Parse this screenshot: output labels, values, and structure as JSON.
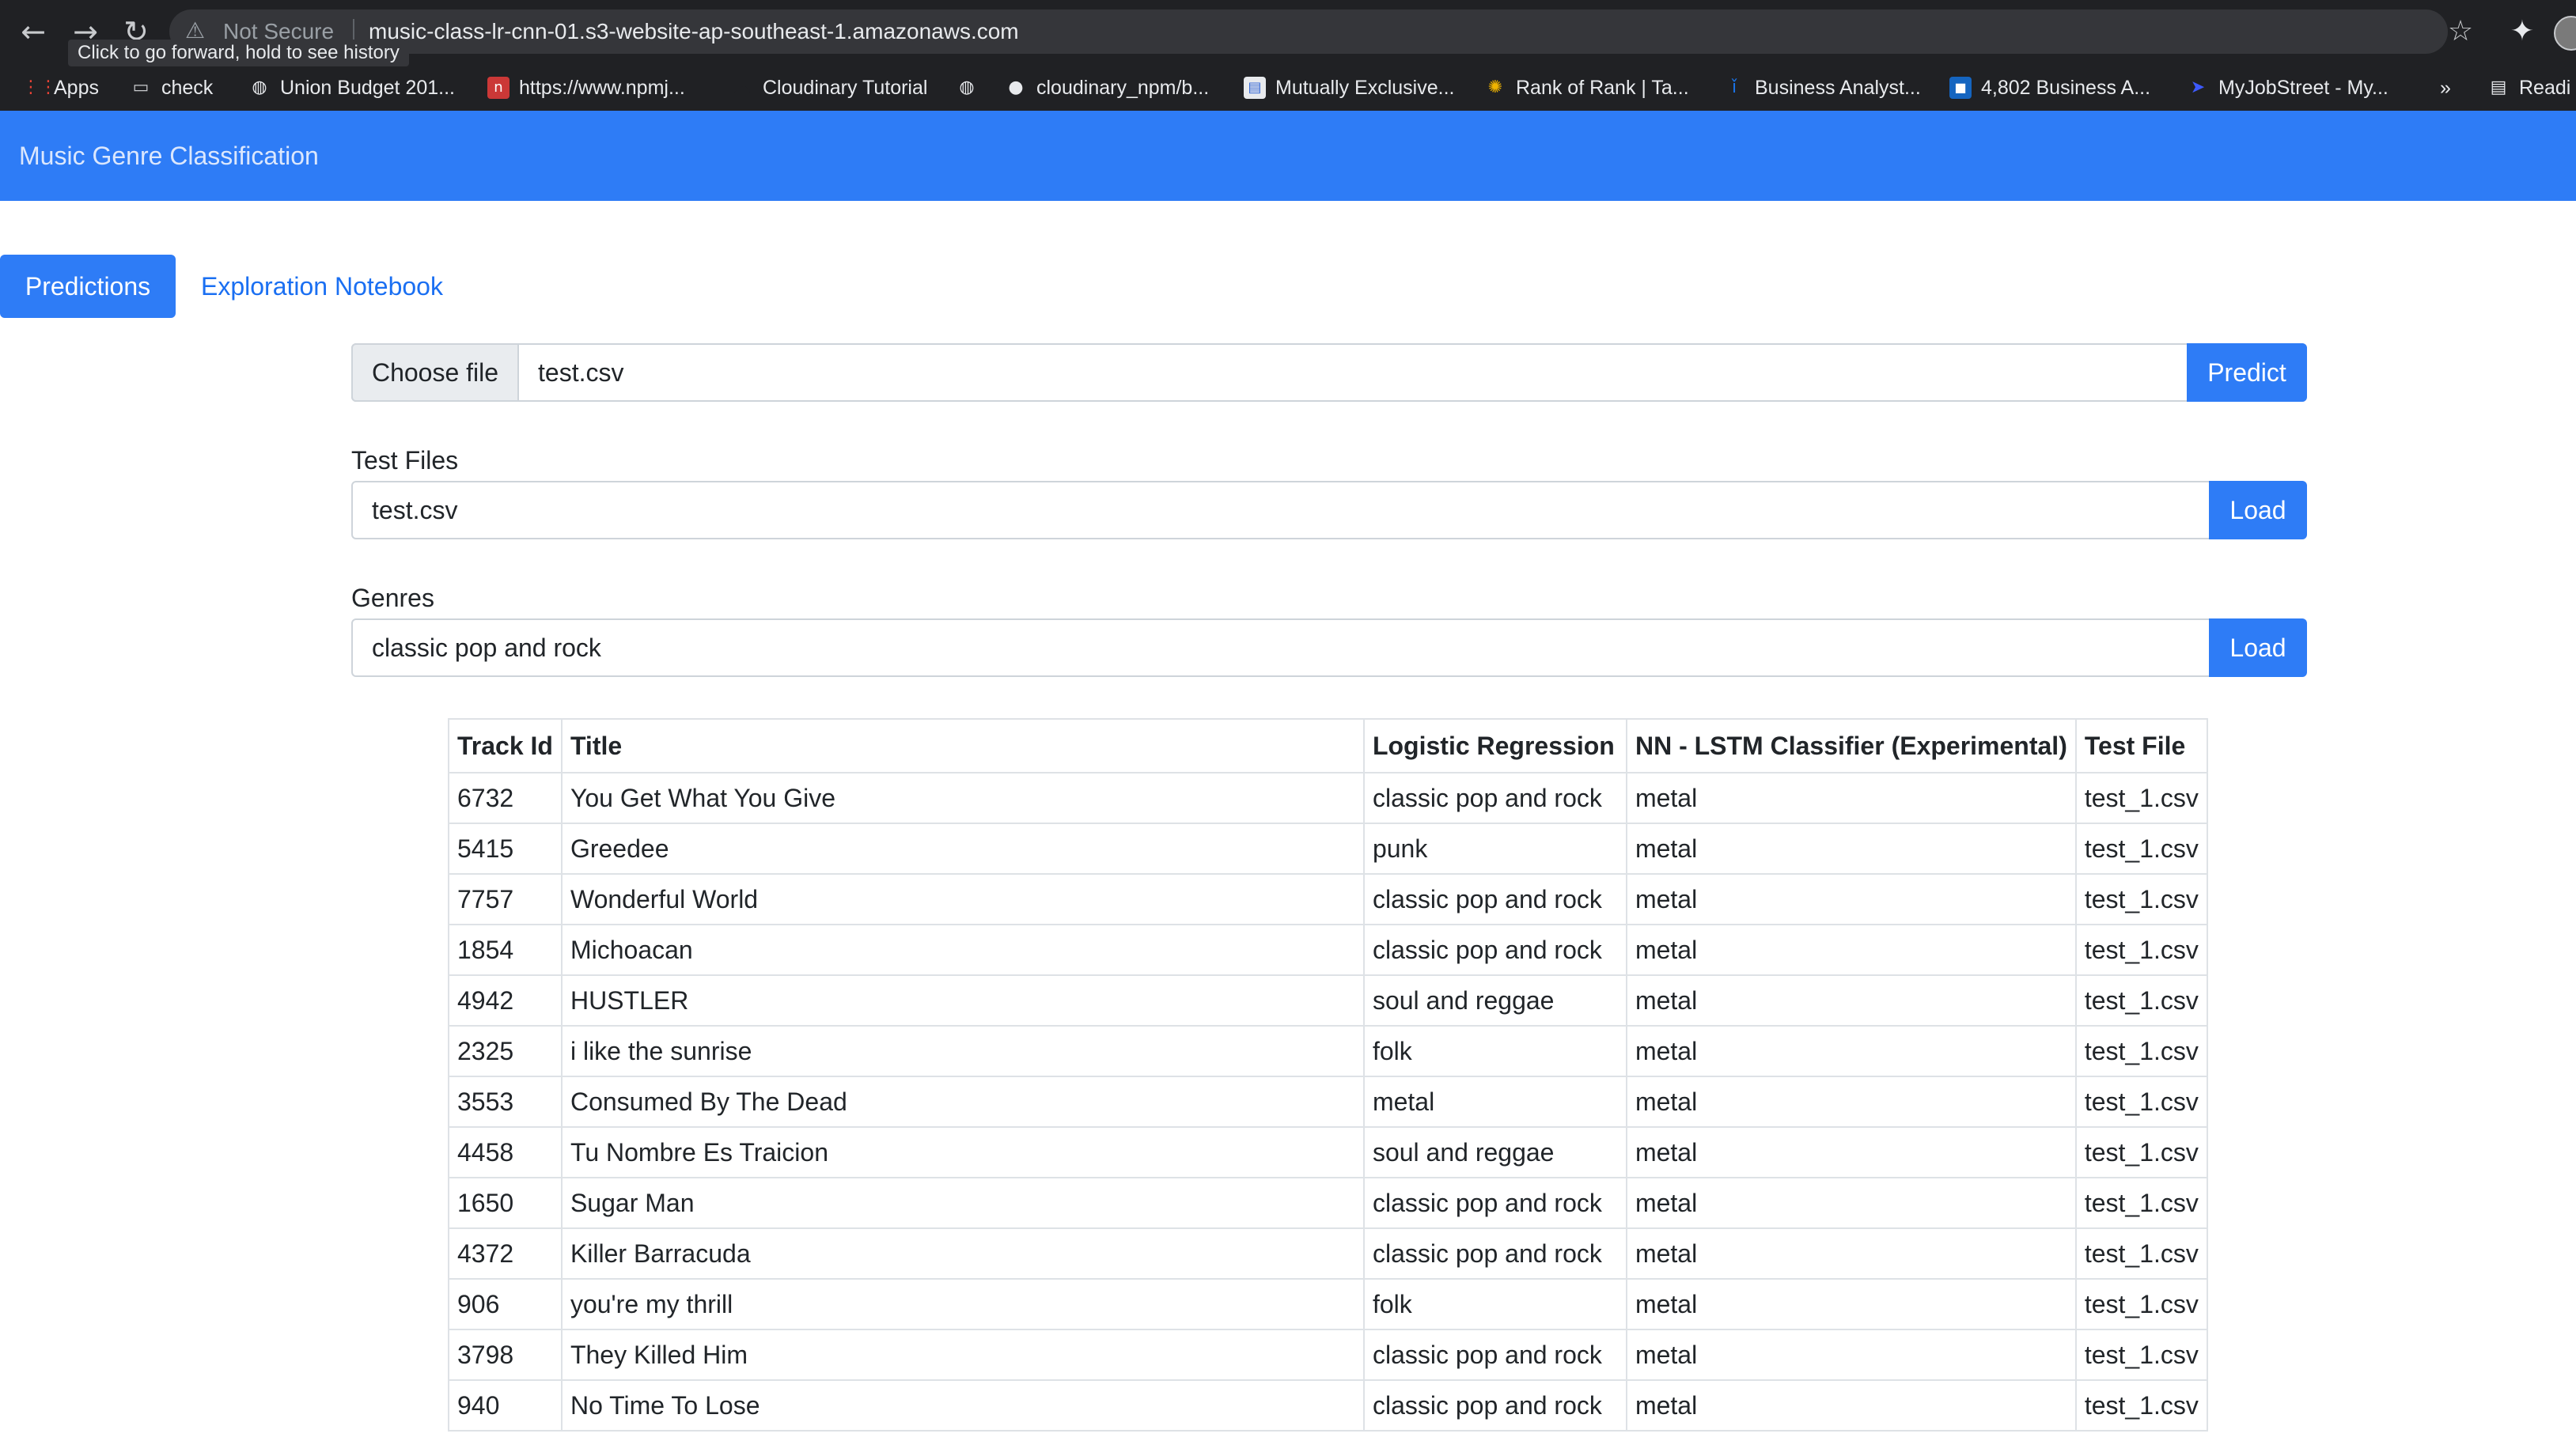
{
  "browser": {
    "security_text": "Not Secure",
    "url": "music-class-lr-cnn-01.s3-website-ap-southeast-1.amazonaws.com",
    "tooltip": "Click to go forward, hold to see history",
    "bookmarks": [
      {
        "label": "Apps",
        "icon": "apps-grid-icon"
      },
      {
        "label": "check",
        "icon": "folder-icon"
      },
      {
        "label": "Union Budget 201...",
        "icon": "globe-icon"
      },
      {
        "label": "https://www.npmj...",
        "icon": "npm-icon"
      },
      {
        "label": "Cloudinary Tutorial",
        "icon": "cloud-icon"
      },
      {
        "label": "",
        "icon": "globe-icon"
      },
      {
        "label": "cloudinary_npm/b...",
        "icon": "github-icon"
      },
      {
        "label": "Mutually Exclusive...",
        "icon": "page-icon"
      },
      {
        "label": "Rank of Rank | Ta...",
        "icon": "gear-logo-icon"
      },
      {
        "label": "Business Analyst...",
        "icon": "person-icon"
      },
      {
        "label": "4,802 Business A...",
        "icon": "jobs-icon"
      },
      {
        "label": "MyJobStreet - My...",
        "icon": "arrow-logo-icon"
      },
      {
        "label": "»",
        "icon": ""
      },
      {
        "label": "Readi",
        "icon": "reading-list-icon"
      }
    ]
  },
  "app": {
    "brand": "Music Genre Classification"
  },
  "tabs": {
    "active": "Predictions",
    "other": "Exploration Notebook"
  },
  "upload": {
    "choose_label": "Choose file",
    "file_name": "test.csv",
    "predict_label": "Predict"
  },
  "test_files": {
    "label": "Test Files",
    "selected": "test.csv",
    "load_label": "Load"
  },
  "genres": {
    "label": "Genres",
    "selected": "classic pop and rock",
    "load_label": "Load"
  },
  "table": {
    "headers": [
      "Track Id",
      "Title",
      "Logistic Regression",
      "NN - LSTM Classifier (Experimental)",
      "Test File"
    ],
    "rows": [
      [
        "6732",
        "You Get What You Give",
        "classic pop and rock",
        "metal",
        "test_1.csv"
      ],
      [
        "5415",
        "Greedee",
        "punk",
        "metal",
        "test_1.csv"
      ],
      [
        "7757",
        "Wonderful World",
        "classic pop and rock",
        "metal",
        "test_1.csv"
      ],
      [
        "1854",
        "Michoacan",
        "classic pop and rock",
        "metal",
        "test_1.csv"
      ],
      [
        "4942",
        "HUSTLER",
        "soul and reggae",
        "metal",
        "test_1.csv"
      ],
      [
        "2325",
        "i like the sunrise",
        "folk",
        "metal",
        "test_1.csv"
      ],
      [
        "3553",
        "Consumed By The Dead",
        "metal",
        "metal",
        "test_1.csv"
      ],
      [
        "4458",
        "Tu Nombre Es Traicion",
        "soul and reggae",
        "metal",
        "test_1.csv"
      ],
      [
        "1650",
        "Sugar Man",
        "classic pop and rock",
        "metal",
        "test_1.csv"
      ],
      [
        "4372",
        "Killer Barracuda",
        "classic pop and rock",
        "metal",
        "test_1.csv"
      ],
      [
        "906",
        "you're my thrill",
        "folk",
        "metal",
        "test_1.csv"
      ],
      [
        "3798",
        "They Killed Him",
        "classic pop and rock",
        "metal",
        "test_1.csv"
      ],
      [
        "940",
        "No Time To Lose",
        "classic pop and rock",
        "metal",
        "test_1.csv"
      ]
    ]
  }
}
